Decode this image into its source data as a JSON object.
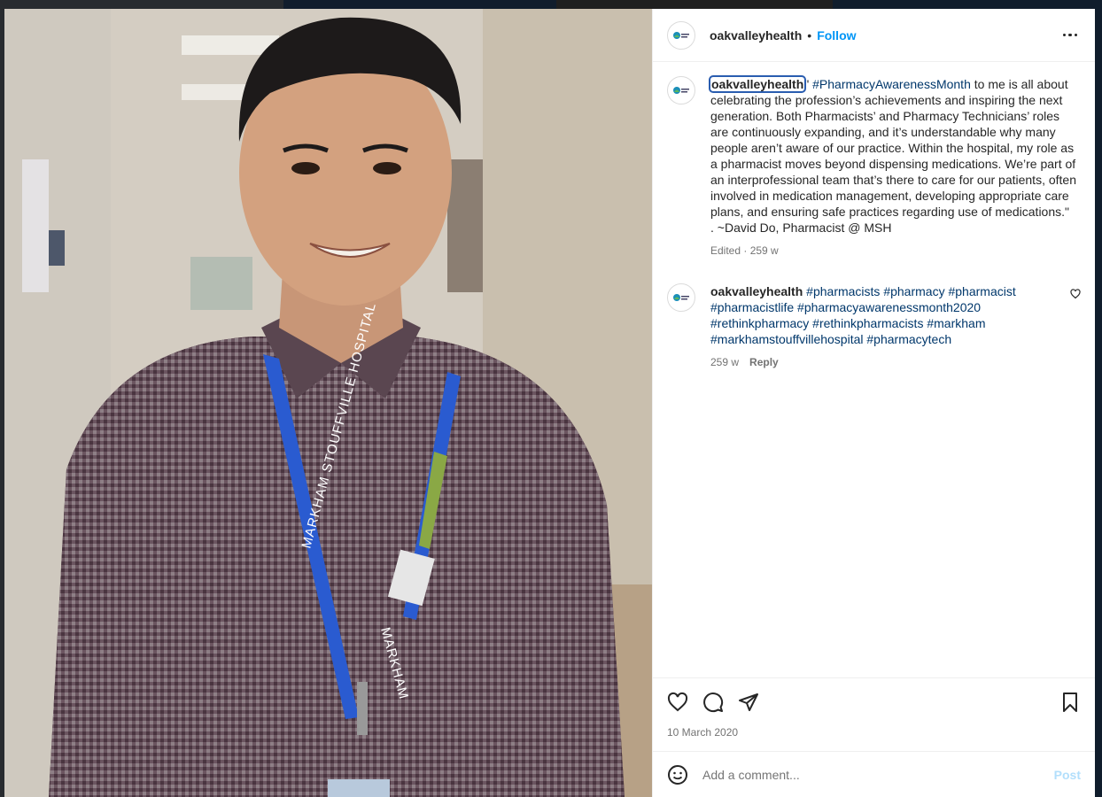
{
  "header": {
    "username": "oakvalleyhealth",
    "separator": "•",
    "follow_label": "Follow"
  },
  "avatar_logo_text": "Oak Valley Health",
  "caption": {
    "username": "oakvalleyhealth",
    "text_before_tag": "\" ",
    "hashtag": "#PharmacyAwarenessMonth",
    "text_after_tag": " to me is all about celebrating the profession’s achievements and inspiring the next generation. Both Pharmacists’ and Pharmacy Technicians’ roles are continuously expanding, and it’s understandable why many people aren’t aware of our practice. Within the hospital, my role as a pharmacist moves beyond dispensing medications. We’re part of an interprofessional team that’s there to care for our patients, often involved in medication management, developing appropriate care plans, and ensuring safe practices regarding use of medications.\"",
    "signature": ". ~David Do, Pharmacist @ MSH",
    "meta": "Edited · 259 w"
  },
  "comment": {
    "username": "oakvalleyhealth",
    "hashtags": [
      "#pharmacists",
      "#pharmacy",
      "#pharmacist",
      "#pharmacistlife",
      "#pharmacyawarenessmonth2020",
      "#rethinkpharmacy",
      "#rethinkpharmacists",
      "#markham",
      "#markhamstouffvillehospital",
      "#pharmacytech"
    ],
    "time": "259 w",
    "reply_label": "Reply"
  },
  "actions": {
    "icons": [
      "heart-icon",
      "comment-icon",
      "share-icon",
      "bookmark-icon"
    ]
  },
  "post_date": "10 March 2020",
  "add_comment": {
    "placeholder": "Add a comment...",
    "post_label": "Post",
    "icon": "emoji-icon"
  },
  "photo": {
    "lanyard_text": "MARKHAM STOUFFVILLE HOSPITAL",
    "lanyard_text_2": "MARKHAM"
  },
  "colors": {
    "accent": "#0095f6",
    "hashtag": "#00376b",
    "muted": "#737373",
    "post_disabled": "#b2dffc"
  }
}
